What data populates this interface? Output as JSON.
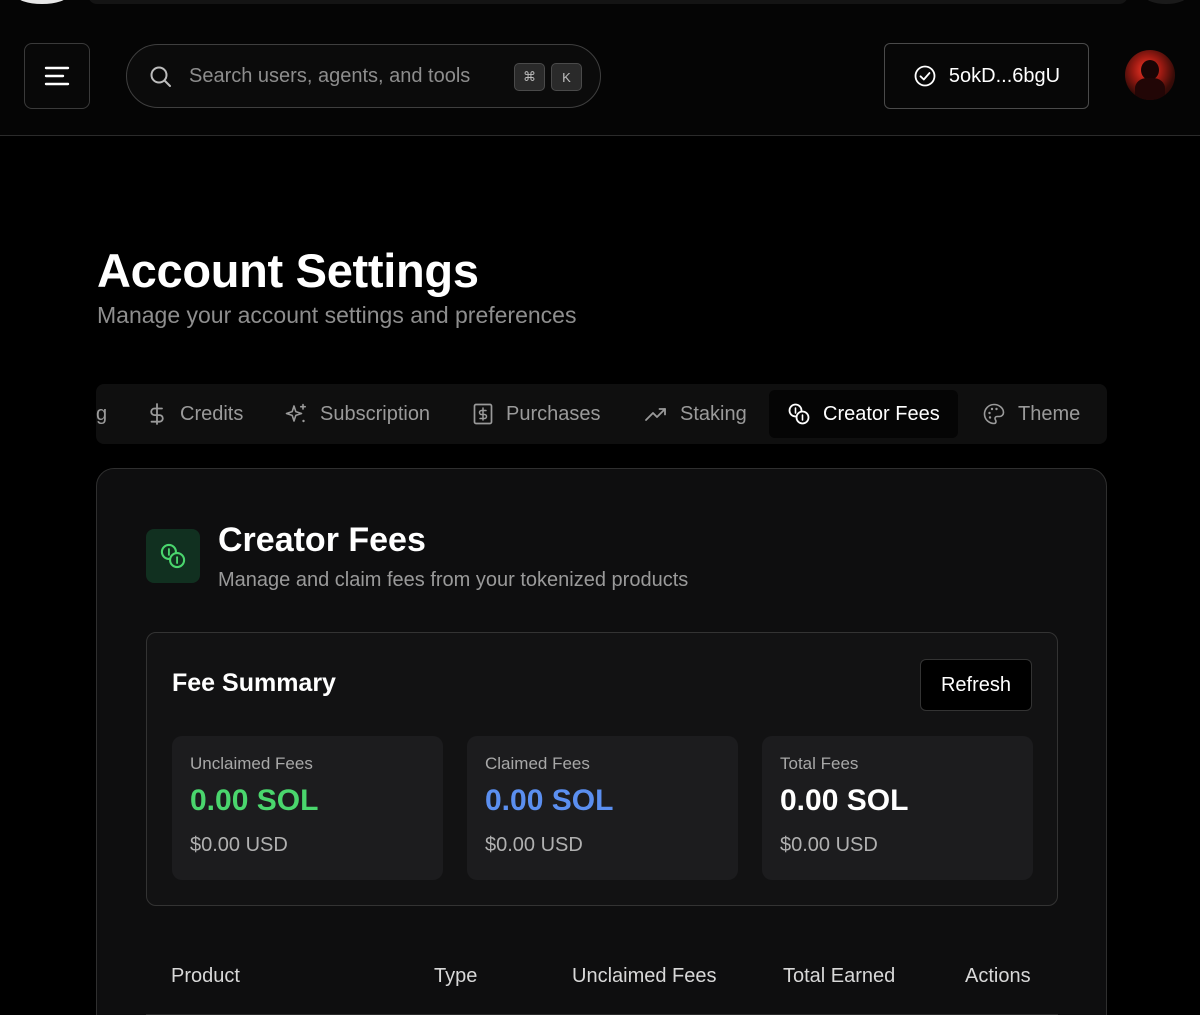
{
  "header": {
    "search_placeholder": "Search users, agents, and tools",
    "shortcut_keys": [
      "⌘",
      "K"
    ],
    "wallet_address": "5okD...6bgU"
  },
  "page": {
    "title": "Account Settings",
    "subtitle": "Manage your account settings and preferences"
  },
  "tabs": [
    {
      "label": "g",
      "icon": "none"
    },
    {
      "label": "Credits",
      "icon": "dollar-icon"
    },
    {
      "label": "Subscription",
      "icon": "sparkles-icon"
    },
    {
      "label": "Purchases",
      "icon": "receipt-icon"
    },
    {
      "label": "Staking",
      "icon": "trending-up-icon"
    },
    {
      "label": "Creator Fees",
      "icon": "coins-icon",
      "active": true
    },
    {
      "label": "Theme",
      "icon": "palette-icon"
    }
  ],
  "creator_fees": {
    "title": "Creator Fees",
    "subtitle": "Manage and claim fees from your tokenized products",
    "accent_color": "#4ad66d"
  },
  "summary": {
    "title": "Fee Summary",
    "refresh_label": "Refresh",
    "stats": [
      {
        "label": "Unclaimed Fees",
        "value": "0.00 SOL",
        "usd": "$0.00 USD",
        "color": "#4ad66d"
      },
      {
        "label": "Claimed Fees",
        "value": "0.00 SOL",
        "usd": "$0.00 USD",
        "color": "#5b8ff0"
      },
      {
        "label": "Total Fees",
        "value": "0.00 SOL",
        "usd": "$0.00 USD",
        "color": "#ffffff"
      }
    ]
  },
  "table": {
    "columns": [
      "Product",
      "Type",
      "Unclaimed Fees",
      "Total Earned",
      "Actions"
    ]
  }
}
